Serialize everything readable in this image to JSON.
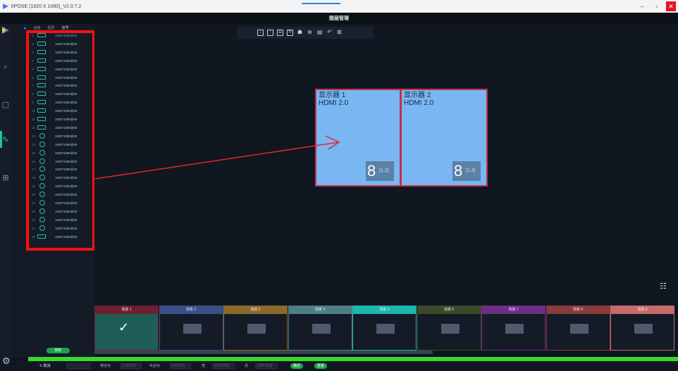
{
  "window": {
    "title": "XPOSE (1920 X 1080)_V2.0.7.2",
    "minimize": "–",
    "maximize": "▫",
    "close": "✕"
  },
  "page_title": "图层管理",
  "source_tabs": [
    "画面",
    "图层",
    "信号"
  ],
  "sources": [
    {
      "n": "1",
      "label": "1920*1080@60"
    },
    {
      "n": "2",
      "label": "1920*1080@60"
    },
    {
      "n": "3",
      "label": "1920*1080@60"
    },
    {
      "n": "4",
      "label": "1920*1080@60"
    },
    {
      "n": "5",
      "label": "1920*1080@60"
    },
    {
      "n": "6",
      "label": "1920*1080@60"
    },
    {
      "n": "7",
      "label": "1920*1080@60"
    },
    {
      "n": "8",
      "label": "1920*1080@60"
    },
    {
      "n": "9",
      "label": "1920*1080@60"
    },
    {
      "n": "10",
      "label": "1920*1080@60"
    },
    {
      "n": "11",
      "label": "1920*1080@60"
    },
    {
      "n": "12",
      "label": "1920*1080@60"
    },
    {
      "n": "13",
      "label": "1920*1080@60"
    },
    {
      "n": "14",
      "label": "1920*1080@60"
    },
    {
      "n": "15",
      "label": "1920*1080@60"
    },
    {
      "n": "16",
      "label": "1920*1080@60"
    },
    {
      "n": "17",
      "label": "1920*1080@60"
    },
    {
      "n": "18",
      "label": "1920*1080@60"
    },
    {
      "n": "19",
      "label": "1920*1080@60"
    },
    {
      "n": "20",
      "label": "1920*1080@60"
    },
    {
      "n": "21",
      "label": "1920*1080@60"
    },
    {
      "n": "22",
      "label": "1920*1080@60"
    },
    {
      "n": "23",
      "label": "1920*1080@60"
    },
    {
      "n": "24",
      "label": "1920*1080@60"
    },
    {
      "n": "25",
      "label": "1920*1080@60"
    }
  ],
  "source_button": "刷新",
  "screens": [
    {
      "name": "显示器 1",
      "port": "HDMI 2.0",
      "badge": "8",
      "badge_sub": "[1,2]"
    },
    {
      "name": "显示器 2",
      "port": "HDMI 2.0",
      "badge": "8",
      "badge_sub": "[1,2]"
    }
  ],
  "groups": [
    {
      "label": "场景 1",
      "color": "#6e1f30"
    },
    {
      "label": "场景 2",
      "color": "#3a4f86"
    },
    {
      "label": "场景 3",
      "color": "#8a6a2b"
    },
    {
      "label": "场景 4",
      "color": "#4e7f86"
    },
    {
      "label": "场景 5",
      "color": "#1bb6ad"
    },
    {
      "label": "场景 6",
      "color": "#3d4a2a"
    },
    {
      "label": "场景 7",
      "color": "#6b2f86"
    },
    {
      "label": "场景 8",
      "color": "#8a3b3b"
    },
    {
      "label": "场景 9",
      "color": "#c76a6a"
    }
  ],
  "bottom": {
    "cancel": "取消",
    "x_label": "横坐标",
    "x_ph": "[-32767]",
    "y_label": "纵坐标",
    "y_ph": "[-32767]",
    "w_label": "宽",
    "w_ph": "[100-655]",
    "h_label": "高",
    "h_ph": "[100-655]",
    "confirm": "确定",
    "reset": "重置"
  }
}
